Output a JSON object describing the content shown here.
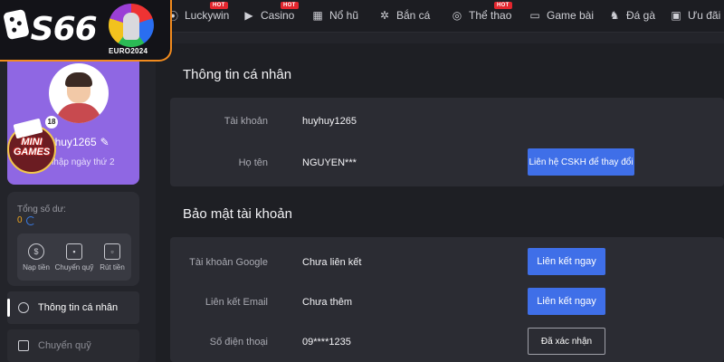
{
  "logo": {
    "brand": "S66",
    "badge_text": "EURO2024"
  },
  "topnav": {
    "items": [
      {
        "label": "Luckywin",
        "icon": "spin-icon",
        "hot": true
      },
      {
        "label": "Casino",
        "icon": "play-icon",
        "hot": true
      },
      {
        "label": "Nổ hũ",
        "icon": "slot-icon",
        "hot": false
      },
      {
        "label": "Bắn cá",
        "icon": "fish-icon",
        "hot": false
      },
      {
        "label": "Thể thao",
        "icon": "sport-icon",
        "hot": true
      },
      {
        "label": "Game bài",
        "icon": "cards-icon",
        "hot": false
      },
      {
        "label": "Đá gà",
        "icon": "rooster-icon",
        "hot": false
      },
      {
        "label": "Ưu đãi",
        "icon": "gift-icon",
        "hot": false
      }
    ],
    "hot_label": "HOT"
  },
  "profile": {
    "username": "huyhuy1265",
    "join_text": "Gia nhập ngày thứ 2",
    "mini_games_badge": "18",
    "mini_games_label": "MINI GAMES"
  },
  "balance": {
    "label": "Tổng số dư:",
    "value": "0"
  },
  "actions": [
    {
      "label": "Nạp tiền",
      "icon": "deposit-icon"
    },
    {
      "label": "Chuyển quỹ",
      "icon": "wallet-icon"
    },
    {
      "label": "Rút tiền",
      "icon": "withdraw-icon"
    }
  ],
  "menu": {
    "personal_info": "Thông tin cá nhân",
    "transfer": "Chuyển quỹ"
  },
  "personal_section": {
    "title": "Thông tin cá nhân",
    "account_label": "Tài khoản",
    "account_value": "huyhuy1265",
    "name_label": "Họ tên",
    "name_value": "NGUYEN***",
    "contact_button": "Liên hệ CSKH để thay đổi"
  },
  "security_section": {
    "title": "Bảo mật tài khoản",
    "google_label": "Tài khoản Google",
    "google_value": "Chưa liên kết",
    "google_button": "Liên kết ngay",
    "email_label": "Liên kết Email",
    "email_value": "Chưa thêm",
    "email_button": "Liên kết ngay",
    "phone_label": "Số điện thoại",
    "phone_value": "09****1235",
    "phone_button": "Đã xác nhận"
  },
  "colors": {
    "accent_blue": "#3f6fe8",
    "profile_purple": "#8f67e3",
    "hot_red": "#e2262e",
    "logo_orange": "#f28b1e",
    "balance_orange": "#f0a61e"
  }
}
